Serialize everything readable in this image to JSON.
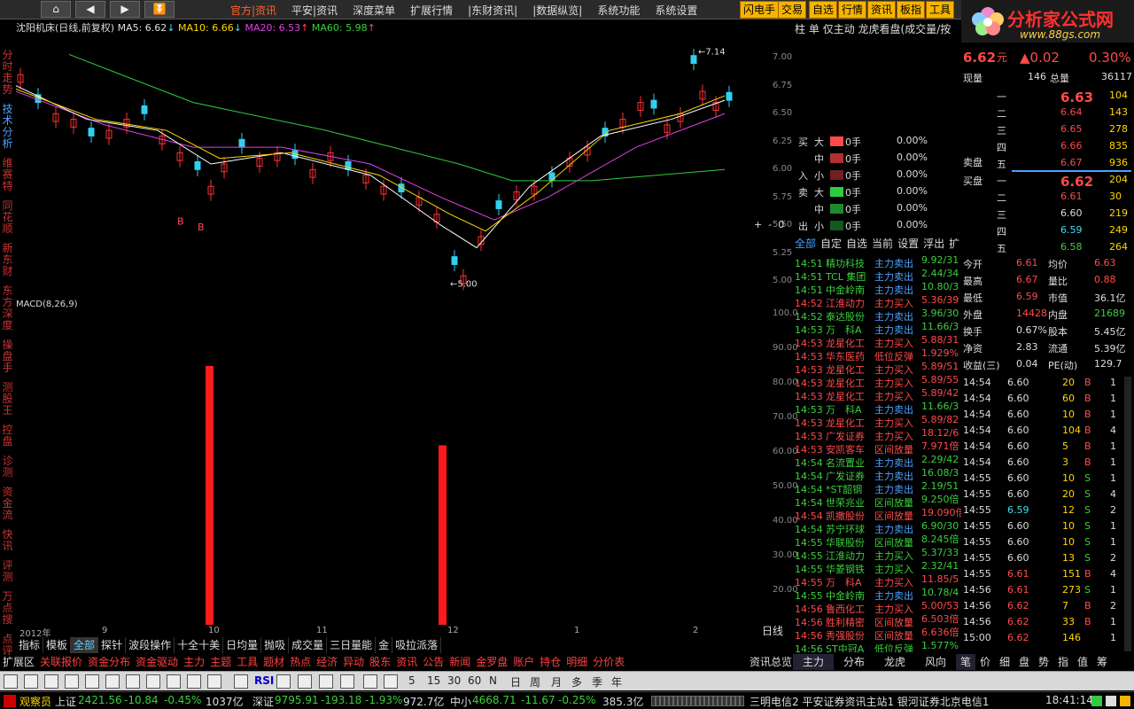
{
  "nav": {
    "home": "⌂",
    "back": "◀",
    "forward": "▶",
    "more": "⏬"
  },
  "menu": [
    "官方|资讯",
    "平安|资讯",
    "深度菜单",
    "扩展行情",
    "|东财资讯|",
    "|数据纵览|",
    "系统功能",
    "系统设置"
  ],
  "top_buttons": [
    "闪电手",
    "交易",
    "自选",
    "行情",
    "资讯",
    "板指",
    "工具"
  ],
  "logo": {
    "title": "分析家公式网",
    "url": "www.88gs.com"
  },
  "chart_title": {
    "stock": "沈阳机床(日线,前复权)",
    "ma5_label": "MA5: 6.62",
    "ma10_label": "MA10: 6.66",
    "ma20_label": "MA20: 6.53",
    "ma60_label": "MA60: 5.98"
  },
  "left_nav": [
    "分时走势",
    "技术分析",
    "维赛特",
    "同花顺",
    "新东财",
    "东方深度",
    "操盘手",
    "测股王",
    "控盘",
    "诊测",
    "资金流",
    "快讯",
    "评测",
    "万点搜",
    "点评"
  ],
  "price_axis": [
    "7.00",
    "6.75",
    "6.50",
    "6.25",
    "6.00",
    "5.75",
    "5.50",
    "5.25",
    "5.00"
  ],
  "macd_label": "MACD(8,26,9)",
  "macd_axis": [
    "100.0",
    "90.00",
    "80.00",
    "70.00",
    "60.00",
    "50.00",
    "40.00",
    "30.00",
    "20.00"
  ],
  "x_labels": [
    "2012年",
    "9",
    "10",
    "11",
    "12",
    "1",
    "2"
  ],
  "period_label": "日线",
  "annotations": {
    "high": "7.14",
    "low": "5.00",
    "buy": "B"
  },
  "bottom_tabs": [
    "指标",
    "模板",
    "全部",
    "探针",
    "波段操作",
    "十全十美",
    "日均量",
    "抛吸",
    "成交量",
    "三日量能",
    "金",
    "吸拉派落"
  ],
  "row2_tabs": [
    "扩展区",
    "关联报价",
    "资金分布",
    "资金驱动",
    "主力",
    "主题",
    "工具",
    "题材",
    "热点",
    "经济",
    "异动",
    "股东",
    "资讯",
    "公告",
    "新闻",
    "金罗盘",
    "账户",
    "持仓",
    "明细",
    "分价表"
  ],
  "right_top": [
    "柱",
    "单",
    "仅主动",
    "龙虎看盘(成交量/按"
  ],
  "flow": [
    {
      "side": "买",
      "size": "大",
      "qty": "0手",
      "pct": "0.00%",
      "color": "#ff4a4a"
    },
    {
      "side": "",
      "size": "中",
      "qty": "0手",
      "pct": "0.00%",
      "color": "#b03030"
    },
    {
      "side": "入",
      "size": "小",
      "qty": "0手",
      "pct": "0.00%",
      "color": "#702020"
    },
    {
      "side": "卖",
      "size": "大",
      "qty": "0手",
      "pct": "0.00%",
      "color": "#2ecc40"
    },
    {
      "side": "",
      "size": "中",
      "qty": "0手",
      "pct": "0.00%",
      "color": "#1f8a2c"
    },
    {
      "side": "出",
      "size": "小",
      "qty": "0手",
      "pct": "0.00%",
      "color": "#125a1c"
    }
  ],
  "flow_plus": "+",
  "flow_minus": "-",
  "flow_zero": "0",
  "tick_header": [
    "全部",
    "自定",
    "自选",
    "当前",
    "设置",
    "浮出",
    "扩"
  ],
  "ticks": [
    {
      "t": "14:51",
      "n": "精功科技",
      "a": "主力卖出",
      "v": "9.92/31",
      "c": "g"
    },
    {
      "t": "14:51",
      "n": "TCL 集团",
      "a": "主力卖出",
      "v": "2.44/34",
      "c": "g"
    },
    {
      "t": "14:51",
      "n": "中金岭南",
      "a": "主力卖出",
      "v": "10.80/3",
      "c": "g"
    },
    {
      "t": "14:52",
      "n": "江淮动力",
      "a": "主力买入",
      "v": "5.36/39",
      "c": "r"
    },
    {
      "t": "14:52",
      "n": "泰达股份",
      "a": "主力卖出",
      "v": "3.96/30",
      "c": "g"
    },
    {
      "t": "14:53",
      "n": "万　科A",
      "a": "主力卖出",
      "v": "11.66/3",
      "c": "g"
    },
    {
      "t": "14:53",
      "n": "龙星化工",
      "a": "主力买入",
      "v": "5.88/31",
      "c": "r"
    },
    {
      "t": "14:53",
      "n": "华东医药",
      "a": "低位反弹",
      "v": "1.929%",
      "c": "r"
    },
    {
      "t": "14:53",
      "n": "龙星化工",
      "a": "主力买入",
      "v": "5.89/51",
      "c": "r"
    },
    {
      "t": "14:53",
      "n": "龙星化工",
      "a": "主力买入",
      "v": "5.89/55",
      "c": "r"
    },
    {
      "t": "14:53",
      "n": "龙星化工",
      "a": "主力买入",
      "v": "5.89/42",
      "c": "r"
    },
    {
      "t": "14:53",
      "n": "万　科A",
      "a": "主力卖出",
      "v": "11.66/3",
      "c": "g"
    },
    {
      "t": "14:53",
      "n": "龙星化工",
      "a": "主力买入",
      "v": "5.89/82",
      "c": "r"
    },
    {
      "t": "14:53",
      "n": "广发证券",
      "a": "主力买入",
      "v": "18.12/6",
      "c": "r"
    },
    {
      "t": "14:53",
      "n": "安凯客车",
      "a": "区间放量",
      "v": "7.971倍",
      "c": "r"
    },
    {
      "t": "14:54",
      "n": "名流置业",
      "a": "主力卖出",
      "v": "2.29/42",
      "c": "g"
    },
    {
      "t": "14:54",
      "n": "广发证券",
      "a": "主力卖出",
      "v": "16.08/3",
      "c": "g"
    },
    {
      "t": "14:54",
      "n": "*ST韶钢",
      "a": "主力卖出",
      "v": "2.19/51",
      "c": "g"
    },
    {
      "t": "14:54",
      "n": "世荣兆业",
      "a": "区间放量",
      "v": "9.250倍",
      "c": "g"
    },
    {
      "t": "14:54",
      "n": "凯撒股份",
      "a": "区间放量",
      "v": "19.090倍",
      "c": "r"
    },
    {
      "t": "14:54",
      "n": "苏宁环球",
      "a": "主力卖出",
      "v": "6.90/30",
      "c": "g"
    },
    {
      "t": "14:55",
      "n": "华联股份",
      "a": "区间放量",
      "v": "8.245倍",
      "c": "g"
    },
    {
      "t": "14:55",
      "n": "江淮动力",
      "a": "主力买入",
      "v": "5.37/33",
      "c": "g"
    },
    {
      "t": "14:55",
      "n": "华菱钢铁",
      "a": "主力买入",
      "v": "2.32/41",
      "c": "g"
    },
    {
      "t": "14:55",
      "n": "万　科A",
      "a": "主力买入",
      "v": "11.85/5",
      "c": "r"
    },
    {
      "t": "14:55",
      "n": "中金岭南",
      "a": "主力卖出",
      "v": "10.78/4",
      "c": "g"
    },
    {
      "t": "14:56",
      "n": "鲁西化工",
      "a": "主力买入",
      "v": "5.00/53",
      "c": "r"
    },
    {
      "t": "14:56",
      "n": "胜利精密",
      "a": "区间放量",
      "v": "6.503倍",
      "c": "r"
    },
    {
      "t": "14:56",
      "n": "秀强股份",
      "a": "区间放量",
      "v": "6.636倍",
      "c": "r"
    },
    {
      "t": "14:56",
      "n": "ST中冠A",
      "a": "低位反弹",
      "v": "1.577%",
      "c": "g"
    }
  ],
  "quote": {
    "price": "6.62",
    "unit": "元",
    "change": "▲0.02",
    "pct": "0.30%",
    "now_label": "现量",
    "now_val": "146",
    "total_label": "总量",
    "total_val": "36117",
    "sells": [
      {
        "l": "五",
        "p": "6.67",
        "v": "936"
      },
      {
        "l": "四",
        "p": "6.66",
        "v": "835"
      },
      {
        "l": "三",
        "p": "6.65",
        "v": "278"
      },
      {
        "l": "二",
        "p": "6.64",
        "v": "143"
      },
      {
        "l": "一",
        "p": "6.63",
        "v": "104"
      }
    ],
    "sell_label": "卖盘",
    "buy_label": "买盘",
    "buys": [
      {
        "l": "一",
        "p": "6.62",
        "v": "204"
      },
      {
        "l": "二",
        "p": "6.61",
        "v": "30"
      },
      {
        "l": "三",
        "p": "6.60",
        "v": "219"
      },
      {
        "l": "四",
        "p": "6.59",
        "v": "249"
      },
      {
        "l": "五",
        "p": "6.58",
        "v": "264"
      }
    ],
    "stats": [
      {
        "a": "今开",
        "av": "6.61",
        "b": "均价",
        "bv": "6.63"
      },
      {
        "a": "最高",
        "av": "6.67",
        "b": "量比",
        "bv": "0.88"
      },
      {
        "a": "最低",
        "av": "6.59",
        "b": "市值",
        "bv": "36.1亿"
      },
      {
        "a": "外盘",
        "av": "14428",
        "b": "内盘",
        "bv": "21689"
      },
      {
        "a": "换手",
        "av": "0.67%",
        "b": "股本",
        "bv": "5.45亿"
      },
      {
        "a": "净资",
        "av": "2.83",
        "b": "流通",
        "bv": "5.39亿"
      },
      {
        "a": "收益(三)",
        "av": "0.04",
        "b": "PE(动)",
        "bv": "129.7"
      }
    ],
    "trades": [
      {
        "t": "14:54",
        "p": "6.60",
        "v": "20",
        "d": "B",
        "n": "1"
      },
      {
        "t": "14:54",
        "p": "6.60",
        "v": "60",
        "d": "B",
        "n": "1"
      },
      {
        "t": "14:54",
        "p": "6.60",
        "v": "10",
        "d": "B",
        "n": "1"
      },
      {
        "t": "14:54",
        "p": "6.60",
        "v": "104",
        "d": "B",
        "n": "4"
      },
      {
        "t": "14:54",
        "p": "6.60",
        "v": "5",
        "d": "B",
        "n": "1"
      },
      {
        "t": "14:54",
        "p": "6.60",
        "v": "3",
        "d": "B",
        "n": "1"
      },
      {
        "t": "14:55",
        "p": "6.60",
        "v": "10",
        "d": "S",
        "n": "1"
      },
      {
        "t": "14:55",
        "p": "6.60",
        "v": "20",
        "d": "S",
        "n": "4"
      },
      {
        "t": "14:55",
        "p": "6.59",
        "v": "12",
        "d": "S",
        "n": "2"
      },
      {
        "t": "14:55",
        "p": "6.60",
        "v": "10",
        "d": "S",
        "n": "1"
      },
      {
        "t": "14:55",
        "p": "6.60",
        "v": "10",
        "d": "S",
        "n": "1"
      },
      {
        "t": "14:55",
        "p": "6.60",
        "v": "13",
        "d": "S",
        "n": "2"
      },
      {
        "t": "14:55",
        "p": "6.61",
        "v": "151",
        "d": "B",
        "n": "4"
      },
      {
        "t": "14:56",
        "p": "6.61",
        "v": "273",
        "d": "S",
        "n": "1"
      },
      {
        "t": "14:56",
        "p": "6.62",
        "v": "7",
        "d": "B",
        "n": "2"
      },
      {
        "t": "14:56",
        "p": "6.62",
        "v": "33",
        "d": "B",
        "n": "1"
      },
      {
        "t": "15:00",
        "p": "6.62",
        "v": "146",
        "d": "",
        "n": "1"
      }
    ]
  },
  "right_tabs": [
    "资讯总览",
    "主力",
    "分布",
    "龙虎",
    "风向",
    "笔",
    "价",
    "细",
    "盘",
    "势",
    "指",
    "值",
    "筹"
  ],
  "toolbar_text": [
    "5",
    "15",
    "30",
    "60",
    "N",
    "日",
    "周",
    "月",
    "多",
    "季",
    "年"
  ],
  "toolbar_rsi": "RSI",
  "status": {
    "user": "观察员",
    "sh_label": "上证",
    "sh": "2421.56",
    "sh_ch": "-10.84",
    "sh_pct": "-0.45%",
    "sh_amt": "1037亿",
    "sz_label": "深证",
    "sz": "9795.91",
    "sz_ch": "-193.18",
    "sz_pct": "-1.93%",
    "sz_amt": "972.7亿",
    "zx_label": "中小",
    "zx": "4668.71",
    "zx_ch": "-11.67",
    "zx_pct": "-0.25%",
    "zx_amt": "385.3亿",
    "servers": "三明电信2  平安证券资讯主站1  银河证券北京电信1",
    "time": "18:41:14"
  },
  "chart_data": {
    "type": "candlestick",
    "ylim": [
      4.9,
      7.2
    ],
    "high_mark": 7.14,
    "low_mark": 5.0,
    "macd_bars": [
      {
        "x_index": "10月初",
        "value": 85
      },
      {
        "x_index": "12月初",
        "value": 62
      }
    ]
  }
}
